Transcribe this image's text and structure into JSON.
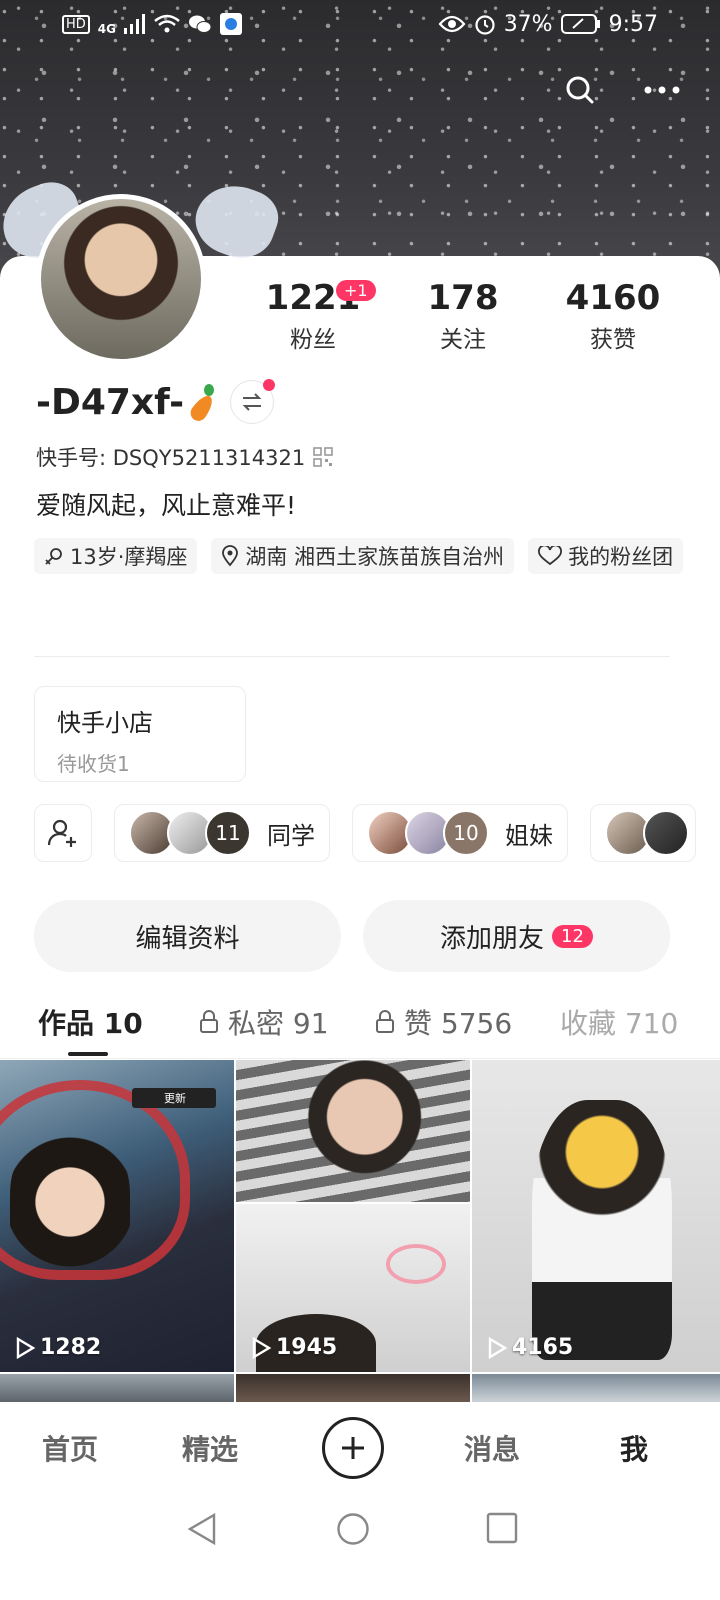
{
  "status_bar": {
    "hd": "HD",
    "network": "4G",
    "battery": "37%",
    "time": "9:57"
  },
  "profile": {
    "stats": [
      {
        "value": "1221",
        "label": "粉丝",
        "badge": "+1"
      },
      {
        "value": "178",
        "label": "关注"
      },
      {
        "value": "4160",
        "label": "获赞"
      }
    ],
    "name": "-D47xf-",
    "kwai_id": "快手号: DSQY5211314321",
    "bio": "爱随风起，风止意难平!",
    "tags": [
      {
        "icon": "gender-icon",
        "text": "13岁·摩羯座"
      },
      {
        "icon": "location-icon",
        "text": "湖南 湘西土家族苗族自治州"
      },
      {
        "icon": "fan-group-icon",
        "text": "我的粉丝团"
      }
    ]
  },
  "shop": {
    "title": "快手小店",
    "subtitle": "待收货1"
  },
  "groups": [
    {
      "count": "11",
      "name": "同学"
    },
    {
      "count": "10",
      "name": "姐妹"
    }
  ],
  "buttons": {
    "edit": "编辑资料",
    "add_friend": "添加朋友",
    "add_friend_badge": "12"
  },
  "tabs": [
    {
      "label": "作品 10"
    },
    {
      "label": "私密 91"
    },
    {
      "label": "赞 5756"
    },
    {
      "label": "收藏 710"
    }
  ],
  "videos": [
    {
      "plays": "1282",
      "badge": "更新"
    },
    {
      "plays": "1945"
    },
    {
      "plays": "4165"
    }
  ],
  "bottom_nav": {
    "home": "首页",
    "featured": "精选",
    "messages": "消息",
    "me": "我"
  },
  "colors": {
    "accent": "#fe3666",
    "text": "#222222",
    "muted": "#999999"
  }
}
